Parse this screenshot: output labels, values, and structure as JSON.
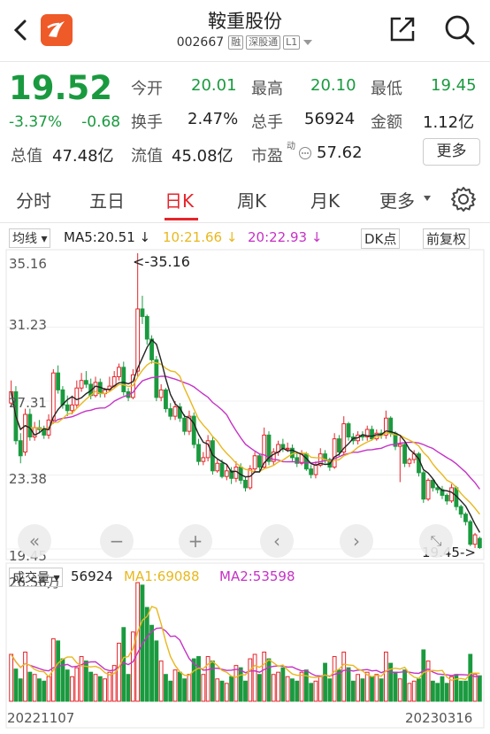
{
  "header": {
    "title": "鞍重股份",
    "code": "002667",
    "tags": [
      "融",
      "深股通",
      "L1"
    ]
  },
  "quote": {
    "price": "19.52",
    "change_pct": "-3.37%",
    "change": "-0.68",
    "open_label": "今开",
    "open": "20.01",
    "high_label": "最高",
    "high": "20.10",
    "low_label": "最低",
    "low": "19.45",
    "turnover_label": "换手",
    "turnover": "2.47%",
    "volume_label": "总手",
    "volume": "56924",
    "amount_label": "金额",
    "amount": "1.12亿",
    "mktcap_label": "总值",
    "mktcap": "47.48亿",
    "float_label": "流值",
    "float": "45.08亿",
    "pe_label": "市盈",
    "pe_sup": "动",
    "pe": "57.62",
    "more": "更多"
  },
  "tabs": [
    "分时",
    "五日",
    "日K",
    "周K",
    "月K",
    "更多"
  ],
  "ma": {
    "type": "均线",
    "ma5": "MA5:20.51",
    "ma10": "10:21.66",
    "ma20": "20:22.93",
    "dk": "DK点",
    "adj": "前复权"
  },
  "price_axis": [
    "35.16",
    "31.23",
    "27.31",
    "23.38",
    "19.45"
  ],
  "max_label": "<-35.16",
  "min_label": "19.45->",
  "vol": {
    "type": "成交量",
    "value": "56924",
    "ma1": "MA1:69088",
    "ma2": "MA2:53598",
    "axis_top": "26.56万"
  },
  "dates": {
    "start": "20221107",
    "end": "20230316"
  },
  "colors": {
    "up": "#e5252b",
    "down": "#1a9a3f",
    "ma5": "#222222",
    "ma10": "#e8b81e",
    "ma20": "#c532c5"
  },
  "chart_data": {
    "type": "candlestick",
    "ylim": [
      19.45,
      35.16
    ],
    "close": [
      27.8,
      25.2,
      24.4,
      26.6,
      25.4,
      25.9,
      25.8,
      25.5,
      26.3,
      28.8,
      27.9,
      27.1,
      26.8,
      27.1,
      28.0,
      28.4,
      28.2,
      27.6,
      28.3,
      27.7,
      27.9,
      28.1,
      28.6,
      29.1,
      27.8,
      27.5,
      28.7,
      32.2,
      31.8,
      30.6,
      29.5,
      27.5,
      27.9,
      26.9,
      26.5,
      27.0,
      26.4,
      25.7,
      26.5,
      25.0,
      24.1,
      24.3,
      25.2,
      23.6,
      24.0,
      23.3,
      23.6,
      23.2,
      23.8,
      23.1,
      22.7,
      23.7,
      24.4,
      23.8,
      25.5,
      24.1,
      24.6,
      25.0,
      24.8,
      24.8,
      24.3,
      24.0,
      24.5,
      23.7,
      23.4,
      23.9,
      24.5,
      24.2,
      23.8,
      25.3,
      24.6,
      26.1,
      25.4,
      25.2,
      25.5,
      25.4,
      25.8,
      25.3,
      25.6,
      25.5,
      26.4,
      25.6,
      24.9,
      25.0,
      24.0,
      24.2,
      24.5,
      23.5,
      22.1,
      23.1,
      22.7,
      22.6,
      22.3,
      22.0,
      22.7,
      21.7,
      21.3,
      20.9,
      19.7,
      20.2,
      19.52
    ],
    "open": [
      27.2,
      27.8,
      25.2,
      24.6,
      26.6,
      25.4,
      25.9,
      25.8,
      25.5,
      26.3,
      28.8,
      27.9,
      27.1,
      26.8,
      27.1,
      28.0,
      28.4,
      28.2,
      27.6,
      28.3,
      27.7,
      27.9,
      28.1,
      28.6,
      29.1,
      27.8,
      27.5,
      28.9,
      32.2,
      31.8,
      30.6,
      29.5,
      27.5,
      27.9,
      26.9,
      26.5,
      27.0,
      26.4,
      25.7,
      26.5,
      25.0,
      24.1,
      24.3,
      25.2,
      23.6,
      24.0,
      23.3,
      23.6,
      23.2,
      23.8,
      23.1,
      22.7,
      23.7,
      24.4,
      23.8,
      25.5,
      24.1,
      24.6,
      25.0,
      24.8,
      24.8,
      24.3,
      24.0,
      24.5,
      23.7,
      23.4,
      23.9,
      24.5,
      24.2,
      23.8,
      25.3,
      24.6,
      26.1,
      25.4,
      25.2,
      25.5,
      25.4,
      25.8,
      25.3,
      25.6,
      25.5,
      26.4,
      25.6,
      24.9,
      25.0,
      24.0,
      24.2,
      24.5,
      23.5,
      22.1,
      23.1,
      22.7,
      22.6,
      22.3,
      22.0,
      22.7,
      21.7,
      21.3,
      20.9,
      19.7,
      20.01
    ],
    "high": [
      28.4,
      28.1,
      25.6,
      26.9,
      26.9,
      26.2,
      26.3,
      26.0,
      26.6,
      29.0,
      29.2,
      28.1,
      27.6,
      27.6,
      28.4,
      28.8,
      28.9,
      28.5,
      28.6,
      28.5,
      28.0,
      28.6,
      28.9,
      29.3,
      29.4,
      28.0,
      29.0,
      35.16,
      32.9,
      31.9,
      30.8,
      29.7,
      28.2,
      28.0,
      27.2,
      27.3,
      27.2,
      26.6,
      26.8,
      26.7,
      25.3,
      24.6,
      25.5,
      25.4,
      24.2,
      24.2,
      23.9,
      23.8,
      24.1,
      24.0,
      23.3,
      23.9,
      24.6,
      24.5,
      25.9,
      25.7,
      24.8,
      25.2,
      25.3,
      25.1,
      25.0,
      24.5,
      24.7,
      24.6,
      23.9,
      24.1,
      24.8,
      24.7,
      24.3,
      25.6,
      25.5,
      26.5,
      26.2,
      25.6,
      25.7,
      25.7,
      26.0,
      26.0,
      25.8,
      25.8,
      26.8,
      26.5,
      25.7,
      25.4,
      25.1,
      24.3,
      24.7,
      24.6,
      23.6,
      23.2,
      23.2,
      22.9,
      22.8,
      22.4,
      22.9,
      22.8,
      21.8,
      21.4,
      21.0,
      20.3,
      20.1
    ],
    "low": [
      27.0,
      25.0,
      24.0,
      24.4,
      25.2,
      25.2,
      25.6,
      25.3,
      25.3,
      26.1,
      27.7,
      26.9,
      26.5,
      26.6,
      26.9,
      27.8,
      28.0,
      27.4,
      27.5,
      27.5,
      27.5,
      27.8,
      28.0,
      28.4,
      27.6,
      27.3,
      27.4,
      28.6,
      31.4,
      30.3,
      29.3,
      27.3,
      27.3,
      26.7,
      26.3,
      26.3,
      26.2,
      25.5,
      25.5,
      24.8,
      23.9,
      23.9,
      24.1,
      23.4,
      23.5,
      23.2,
      23.1,
      22.9,
      23.0,
      22.9,
      22.5,
      22.6,
      23.5,
      23.6,
      23.7,
      23.9,
      23.9,
      24.4,
      24.6,
      24.6,
      24.1,
      23.8,
      23.9,
      23.6,
      23.2,
      23.2,
      23.8,
      24.0,
      23.6,
      23.7,
      24.4,
      24.4,
      25.2,
      25.0,
      25.0,
      25.2,
      25.2,
      25.2,
      25.2,
      25.3,
      25.3,
      25.4,
      24.7,
      23.0,
      23.8,
      23.8,
      24.0,
      23.3,
      21.9,
      22.0,
      22.5,
      22.4,
      22.1,
      21.8,
      21.9,
      21.5,
      21.1,
      20.7,
      19.6,
      19.5,
      19.45
    ],
    "volume": [
      10.5,
      7.2,
      5.0,
      11.0,
      6.5,
      6.0,
      5.0,
      4.5,
      5.5,
      14.0,
      13.5,
      9.5,
      7.0,
      5.5,
      7.5,
      10.0,
      9.0,
      6.5,
      6.0,
      5.5,
      5.0,
      6.5,
      8.0,
      13.0,
      16.5,
      6.0,
      15.5,
      26.56,
      26.0,
      21.0,
      17.0,
      13.5,
      9.0,
      6.0,
      4.5,
      7.0,
      6.5,
      5.0,
      6.0,
      9.5,
      10.0,
      6.0,
      10.0,
      9.0,
      5.0,
      4.5,
      4.0,
      5.5,
      8.0,
      7.5,
      4.5,
      9.5,
      10.5,
      6.0,
      11.0,
      9.5,
      6.0,
      6.5,
      7.5,
      5.5,
      5.0,
      4.5,
      6.5,
      7.0,
      4.0,
      4.5,
      5.5,
      8.5,
      5.0,
      10.0,
      7.0,
      11.0,
      7.5,
      4.5,
      6.0,
      5.0,
      6.5,
      5.5,
      6.0,
      5.0,
      11.0,
      8.5,
      6.5,
      5.0,
      7.0,
      4.0,
      4.5,
      5.0,
      11.5,
      9.0,
      4.5,
      4.0,
      5.5,
      4.0,
      5.5,
      6.0,
      4.5,
      4.5,
      10.5,
      6.0,
      5.7
    ]
  }
}
